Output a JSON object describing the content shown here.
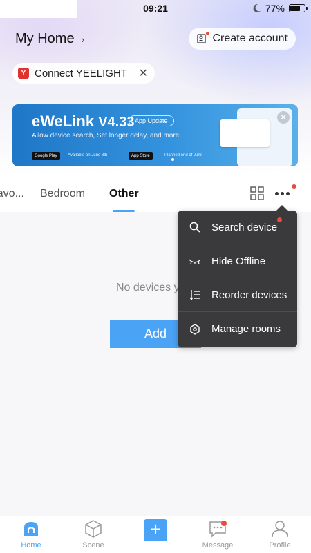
{
  "status_bar": {
    "time": "09:21",
    "battery": "77%"
  },
  "header": {
    "home_title": "My Home",
    "chevron": "›",
    "create_account": "Create account"
  },
  "chip": {
    "logo_text": "Y",
    "label": "Connect YEELIGHT",
    "close": "✕"
  },
  "banner": {
    "brand": "eWeLink",
    "version": "V4.33",
    "badge": "App Update",
    "subtitle": "Allow device search, Set longer delay, and more.",
    "google_play": "Google Play",
    "google_play_note": "Available on June 8th",
    "app_store": "App Store",
    "app_store_note": "Planned end of June",
    "close": "✕"
  },
  "tabs": [
    {
      "label": "Favo..."
    },
    {
      "label": "Bedroom"
    },
    {
      "label": "Other"
    }
  ],
  "empty": {
    "text": "No devices y",
    "add_label": "Add"
  },
  "menu": {
    "items": [
      {
        "label": "Search device",
        "icon": "search-icon"
      },
      {
        "label": "Hide Offline",
        "icon": "eye-closed-icon"
      },
      {
        "label": "Reorder devices",
        "icon": "reorder-icon"
      },
      {
        "label": "Manage rooms",
        "icon": "gear-icon"
      }
    ]
  },
  "bottom_nav": [
    {
      "label": "Home",
      "icon": "home-icon"
    },
    {
      "label": "Scene",
      "icon": "scene-icon"
    },
    {
      "label": "",
      "icon": "plus-icon"
    },
    {
      "label": "Message",
      "icon": "message-icon"
    },
    {
      "label": "Profile",
      "icon": "profile-icon"
    }
  ],
  "colors": {
    "accent": "#4aa3f5",
    "badge_red": "#e84c3d",
    "menu_bg": "#3a3a3c"
  }
}
